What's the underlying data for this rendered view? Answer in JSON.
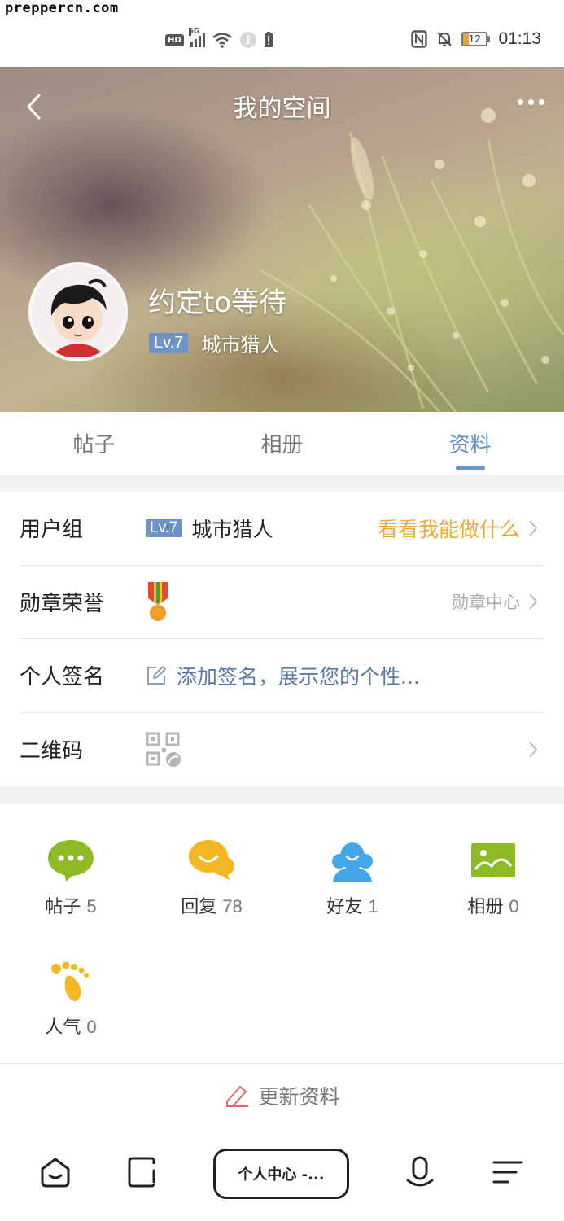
{
  "status_bar": {
    "watermark": "preppercn.com",
    "network_label": "HD",
    "signal_label": "5G",
    "battery_level": "12",
    "time": "01:13"
  },
  "header": {
    "title": "我的空间",
    "username": "约定to等待",
    "level": "Lv.7",
    "group": "城市猎人"
  },
  "tabs": [
    {
      "label": "帖子",
      "active": false
    },
    {
      "label": "相册",
      "active": false
    },
    {
      "label": "资料",
      "active": true
    }
  ],
  "profile": {
    "user_group": {
      "label": "用户组",
      "level": "Lv.7",
      "value": "城市猎人",
      "action": "看看我能做什么"
    },
    "medals": {
      "label": "勋章荣誉",
      "action": "勋章中心"
    },
    "signature": {
      "label": "个人签名",
      "placeholder": "添加签名，展示您的个性..."
    },
    "qrcode": {
      "label": "二维码"
    }
  },
  "stats": [
    {
      "label": "帖子",
      "count": "5",
      "icon": "chat-bubble-icon",
      "color": "#8dbb25"
    },
    {
      "label": "回复",
      "count": "78",
      "icon": "reply-bubble-icon",
      "color": "#f5b623"
    },
    {
      "label": "好友",
      "count": "1",
      "icon": "friends-icon",
      "color": "#42a7e8"
    },
    {
      "label": "相册",
      "count": "0",
      "icon": "album-icon",
      "color": "#8dbb25"
    },
    {
      "label": "人气",
      "count": "0",
      "icon": "footprint-icon",
      "color": "#f5b623"
    }
  ],
  "update_label": "更新资料",
  "bottom_nav": {
    "center_label": "个人中心 -...",
    "icons": [
      "home-icon",
      "square-icon",
      "mic-icon",
      "menu-icon"
    ]
  },
  "colors": {
    "accent": "#5b8dc9",
    "level_badge": "#6b93c7",
    "orange": "#f0a836"
  }
}
